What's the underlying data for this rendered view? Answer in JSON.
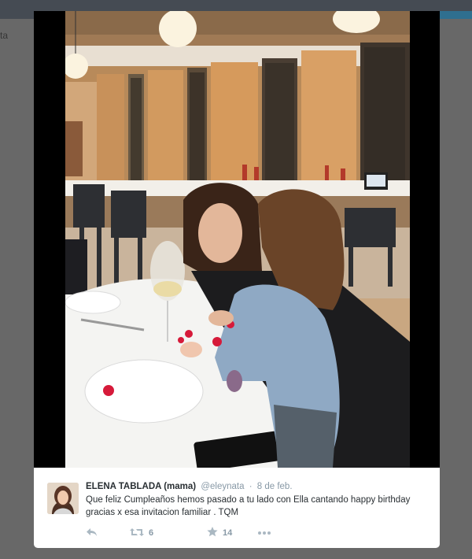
{
  "background": {
    "partial_handle": "ta"
  },
  "tweet": {
    "author_name": "ELENA TABLADA (mama)",
    "author_handle": "@eleynata",
    "separator": "·",
    "time": "8 de feb.",
    "text": "Que feliz Cumpleaños hemos pasado a tu lado con Ella cantando happy birthday gracias x esa invitacion familiar . TQM",
    "actions": {
      "reply_icon": "reply-icon",
      "retweet_icon": "retweet-icon",
      "retweet_count": "6",
      "favorite_icon": "star-icon",
      "favorite_count": "14",
      "more_icon": "more-dots-icon"
    }
  },
  "colors": {
    "page_background": "#808080",
    "media_frame": "#000000",
    "card_background": "#ffffff",
    "name_text": "#292f33",
    "meta_text": "#8899a6",
    "action_icons": "#aab8c2"
  }
}
